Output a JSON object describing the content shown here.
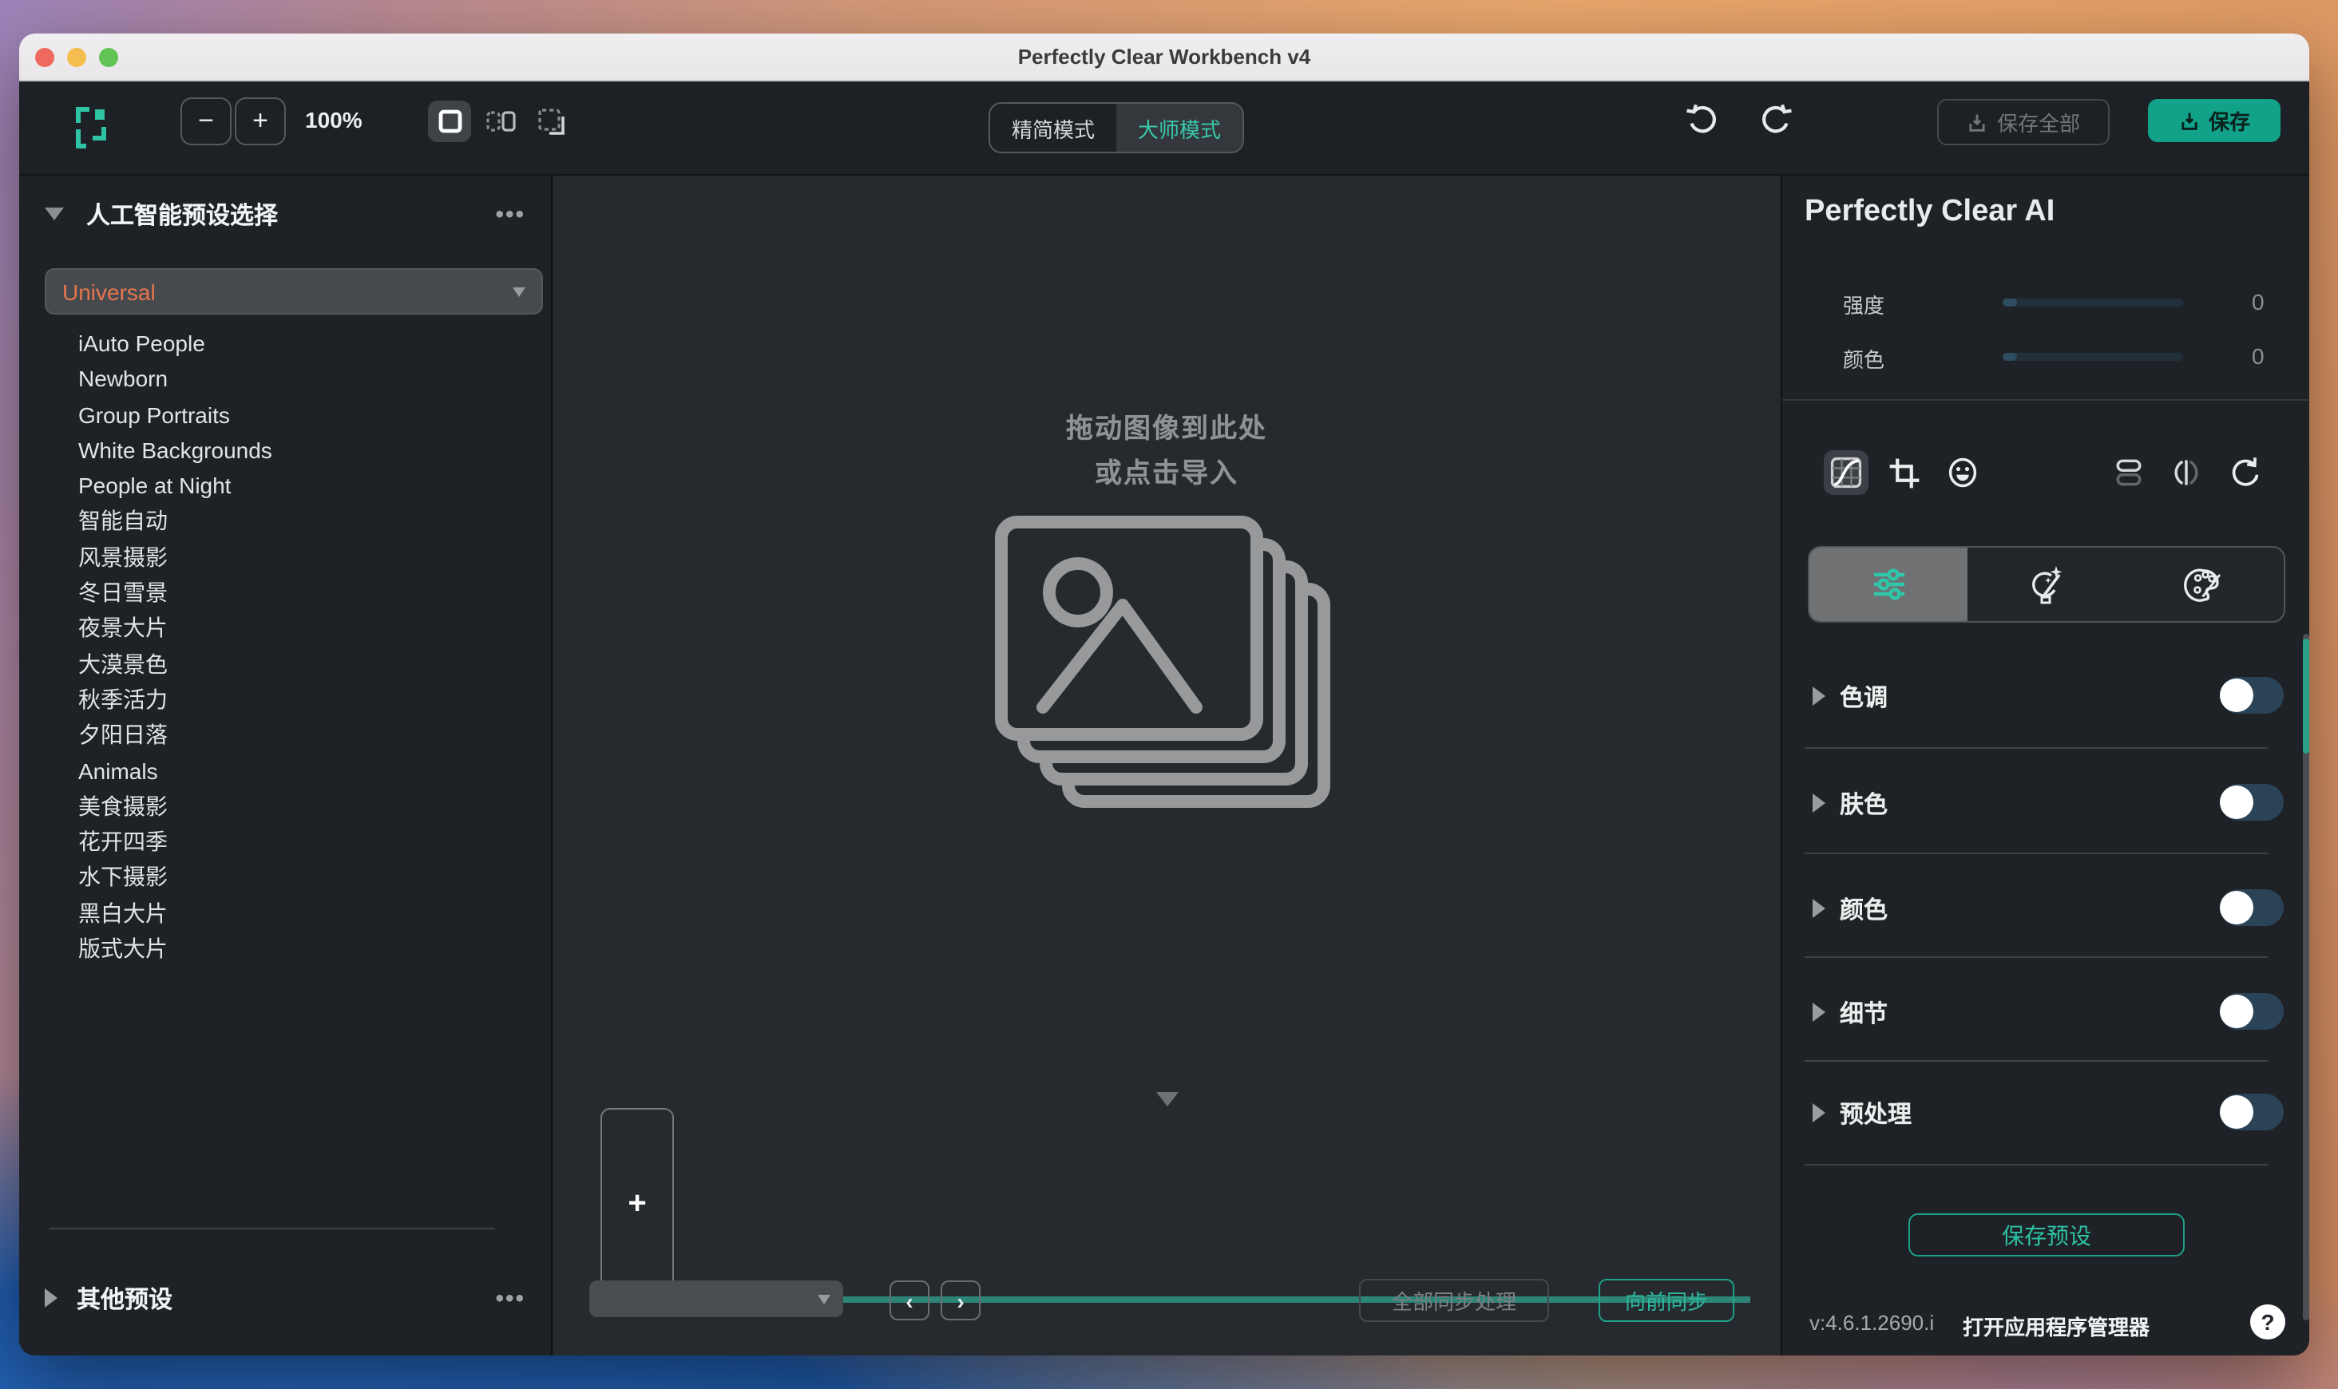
{
  "window": {
    "title": "Perfectly Clear Workbench v4"
  },
  "toolbar": {
    "zoom_out": "−",
    "zoom_in": "+",
    "zoom_level": "100%",
    "mode_simple": "精简模式",
    "mode_master": "大师模式",
    "save_all_label": "保存全部",
    "save_label": "保存"
  },
  "sidebar": {
    "header": "人工智能预设选择",
    "menu_dots": "•••",
    "dropdown_value": "Universal",
    "presets": [
      "iAuto People",
      "Newborn",
      "Group Portraits",
      "White Backgrounds",
      "People at Night",
      "智能自动",
      "风景摄影",
      "冬日雪景",
      "夜景大片",
      "大漠景色",
      "秋季活力",
      "夕阳日落",
      "Animals",
      "美食摄影",
      "花开四季",
      "水下摄影",
      "黑白大片",
      "版式大片"
    ],
    "other_presets": "其他预设"
  },
  "canvas": {
    "drop_line1": "拖动图像到此处",
    "drop_line2": "或点击导入"
  },
  "filmstrip": {
    "add_label": "+",
    "prev_label": "‹",
    "next_label": "›",
    "sync_all_label": "全部同步处理",
    "sync_forward_label": "向前同步"
  },
  "right_panel": {
    "title": "Perfectly Clear AI",
    "strength_label": "强度",
    "strength_value": "0",
    "color_label": "颜色",
    "color_value": "0",
    "sections": [
      "色调",
      "肤色",
      "颜色",
      "细节",
      "预处理"
    ],
    "save_preset_label": "保存预设",
    "version": "v:4.6.1.2690.i",
    "app_manager_label": "打开应用程序管理器",
    "help_label": "?"
  },
  "colors": {
    "accent_teal": "#2cc3a4",
    "save_button": "#12a28a",
    "progress_bar": "#2c8577",
    "dropdown_value_orange": "#e6764d",
    "toggle_off_track": "#2b4357",
    "panel_bg": "#1e2226",
    "canvas_bg": "#26292d"
  }
}
